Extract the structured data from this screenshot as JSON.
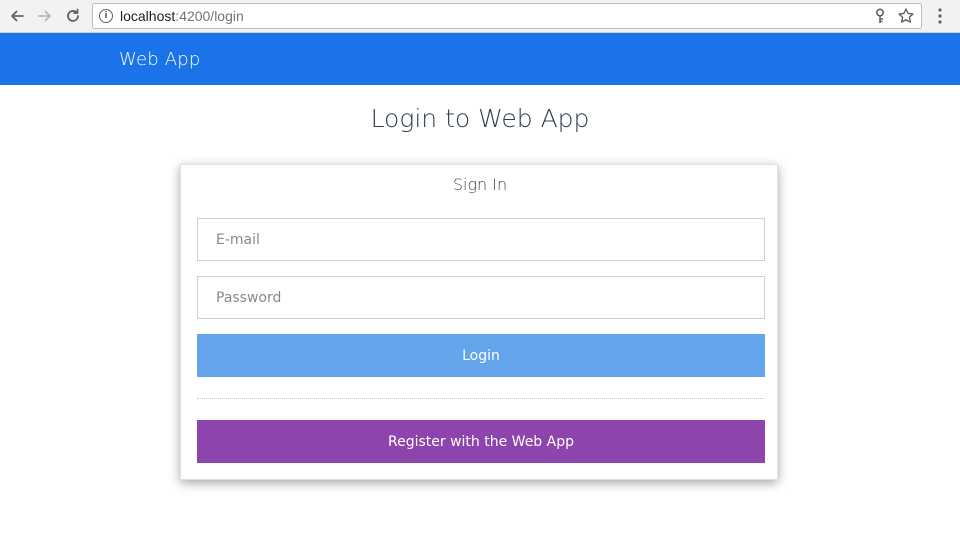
{
  "browser": {
    "url_host": "localhost",
    "url_rest": ":4200/login",
    "icons": [
      "back-arrow-icon",
      "forward-arrow-icon",
      "reload-icon",
      "info-icon",
      "key-icon",
      "star-icon",
      "menu-icon"
    ]
  },
  "header": {
    "app_title": "Web App",
    "background": "#1a73e8"
  },
  "main": {
    "page_title": "Login to Web App",
    "card": {
      "title": "Sign In",
      "email_placeholder": "E-mail",
      "email_value": "",
      "password_placeholder": "Password",
      "password_value": "",
      "login_label": "Login",
      "register_label": "Register with the Web App"
    }
  },
  "colors": {
    "login_button": "#64a4ea",
    "register_button": "#8e44ad"
  }
}
